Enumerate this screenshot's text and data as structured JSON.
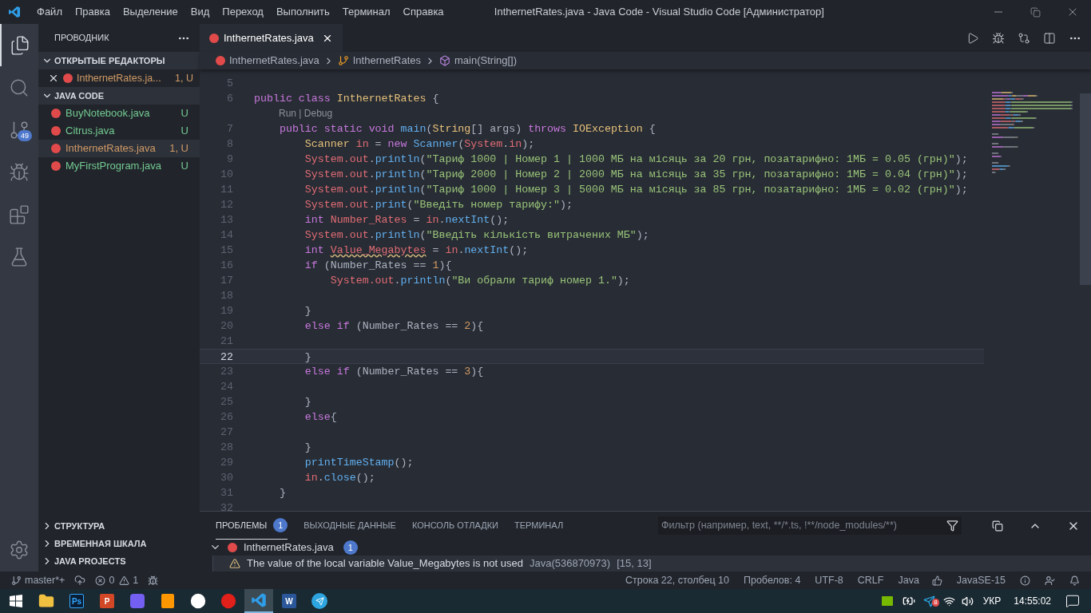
{
  "window": {
    "title": "InthernetRates.java - Java Code - Visual Studio Code [Администратор]"
  },
  "menu": [
    "Файл",
    "Правка",
    "Выделение",
    "Вид",
    "Переход",
    "Выполнить",
    "Терминал",
    "Справка"
  ],
  "activity_bar": [
    {
      "kind": "files",
      "selected": true
    },
    {
      "kind": "search",
      "selected": false
    },
    {
      "kind": "git",
      "selected": false,
      "badge": "49"
    },
    {
      "kind": "debug",
      "selected": false
    },
    {
      "kind": "extensions",
      "selected": false
    },
    {
      "kind": "testing",
      "selected": false
    }
  ],
  "sidebar": {
    "title": "ПРОВОДНИК",
    "open_editors": {
      "title": "ОТКРЫТЫЕ РЕДАКТОРЫ",
      "expanded": true,
      "items": [
        {
          "name": "InthernetRates.ja...",
          "status": "1, U",
          "color": "#d19a66"
        }
      ]
    },
    "folder": {
      "title": "JAVA CODE",
      "expanded": true,
      "items": [
        {
          "name": "BuyNotebook.java",
          "status": "U",
          "color": "#73c991",
          "selected": false
        },
        {
          "name": "Citrus.java",
          "status": "U",
          "color": "#73c991",
          "selected": false
        },
        {
          "name": "InthernetRates.java",
          "status": "1, U",
          "color": "#d19a66",
          "selected": true
        },
        {
          "name": "MyFirstProgram.java",
          "status": "U",
          "color": "#73c991",
          "selected": false
        }
      ]
    },
    "bottom_sections": [
      {
        "title": "СТРУКТУРА",
        "expanded": false
      },
      {
        "title": "ВРЕМЕННАЯ ШКАЛА",
        "expanded": false
      },
      {
        "title": "JAVA PROJECTS",
        "expanded": false
      }
    ]
  },
  "editor": {
    "tab": {
      "name": "InthernetRates.java",
      "selected": true
    },
    "breadcrumbs": [
      {
        "kind": "file",
        "text": "InthernetRates.java"
      },
      {
        "kind": "class",
        "text": "InthernetRates"
      },
      {
        "kind": "method",
        "text": "main(String[])"
      }
    ],
    "lines": [
      {
        "number": "5"
      },
      {
        "number": "6",
        "tokens": [
          {
            "kind": "k",
            "text": "public class "
          },
          {
            "kind": "t",
            "text": "InthernetRates"
          },
          {
            "kind": "p",
            "text": " {"
          }
        ]
      },
      {
        "number": "7",
        "codelens": "Run | Debug",
        "tokens": [
          {
            "kind": "k",
            "text": "    public static void "
          },
          {
            "kind": "f",
            "text": "main"
          },
          {
            "kind": "p",
            "text": "("
          },
          {
            "kind": "t",
            "text": "String"
          },
          {
            "kind": "p",
            "text": "[] args) "
          },
          {
            "kind": "k",
            "text": "throws "
          },
          {
            "kind": "t",
            "text": "IOException"
          },
          {
            "kind": "p",
            "text": " {"
          }
        ]
      },
      {
        "number": "8",
        "tokens": [
          {
            "kind": "t",
            "text": "        Scanner "
          },
          {
            "kind": "v",
            "text": "in"
          },
          {
            "kind": "p",
            "text": " = "
          },
          {
            "kind": "k",
            "text": "new "
          },
          {
            "kind": "f",
            "text": "Scanner"
          },
          {
            "kind": "p",
            "text": "("
          },
          {
            "kind": "v",
            "text": "System"
          },
          {
            "kind": "p",
            "text": "."
          },
          {
            "kind": "v",
            "text": "in"
          },
          {
            "kind": "p",
            "text": ");"
          }
        ]
      },
      {
        "number": "9",
        "tokens": [
          {
            "kind": "v",
            "text": "        System.out"
          },
          {
            "kind": "p",
            "text": "."
          },
          {
            "kind": "f",
            "text": "println"
          },
          {
            "kind": "p",
            "text": "("
          },
          {
            "kind": "s",
            "text": "\"Тариф 1000 | Номер 1 | 1000 МБ на місяць за 20 грн, позатарифно: 1МБ = 0.05 (грн)\""
          },
          {
            "kind": "p",
            "text": ");"
          }
        ]
      },
      {
        "number": "10",
        "tokens": [
          {
            "kind": "v",
            "text": "        System.out"
          },
          {
            "kind": "p",
            "text": "."
          },
          {
            "kind": "f",
            "text": "println"
          },
          {
            "kind": "p",
            "text": "("
          },
          {
            "kind": "s",
            "text": "\"Тариф 2000 | Номер 2 | 2000 МБ на місяць за 35 грн, позатарифно: 1МБ = 0.04 (грн)\""
          },
          {
            "kind": "p",
            "text": ");"
          }
        ]
      },
      {
        "number": "11",
        "tokens": [
          {
            "kind": "v",
            "text": "        System.out"
          },
          {
            "kind": "p",
            "text": "."
          },
          {
            "kind": "f",
            "text": "println"
          },
          {
            "kind": "p",
            "text": "("
          },
          {
            "kind": "s",
            "text": "\"Тариф 1000 | Номер 3 | 5000 МБ на місяць за 85 грн, позатарифно: 1МБ = 0.02 (грн)\""
          },
          {
            "kind": "p",
            "text": ");"
          }
        ]
      },
      {
        "number": "12",
        "tokens": [
          {
            "kind": "v",
            "text": "        System.out"
          },
          {
            "kind": "p",
            "text": "."
          },
          {
            "kind": "f",
            "text": "print"
          },
          {
            "kind": "p",
            "text": "("
          },
          {
            "kind": "s",
            "text": "\"Введіть номер тарифу:\""
          },
          {
            "kind": "p",
            "text": ");"
          }
        ]
      },
      {
        "number": "13",
        "tokens": [
          {
            "kind": "k",
            "text": "        int "
          },
          {
            "kind": "v",
            "text": "Number_Rates"
          },
          {
            "kind": "p",
            "text": " = "
          },
          {
            "kind": "v",
            "text": "in"
          },
          {
            "kind": "p",
            "text": "."
          },
          {
            "kind": "f",
            "text": "nextInt"
          },
          {
            "kind": "p",
            "text": "();"
          }
        ]
      },
      {
        "number": "14",
        "tokens": [
          {
            "kind": "v",
            "text": "        System.out"
          },
          {
            "kind": "p",
            "text": "."
          },
          {
            "kind": "f",
            "text": "println"
          },
          {
            "kind": "p",
            "text": "("
          },
          {
            "kind": "s",
            "text": "\"Введіть кількість витрачених МБ\""
          },
          {
            "kind": "p",
            "text": ");"
          }
        ]
      },
      {
        "number": "15",
        "tokens": [
          {
            "kind": "k",
            "text": "        int "
          },
          {
            "kind": "w",
            "text": "Value_Megabytes"
          },
          {
            "kind": "p",
            "text": " = "
          },
          {
            "kind": "v",
            "text": "in"
          },
          {
            "kind": "p",
            "text": "."
          },
          {
            "kind": "f",
            "text": "nextInt"
          },
          {
            "kind": "p",
            "text": "();"
          }
        ]
      },
      {
        "number": "16",
        "tokens": [
          {
            "kind": "k",
            "text": "        if "
          },
          {
            "kind": "p",
            "text": "(Number_Rates == "
          },
          {
            "kind": "n",
            "text": "1"
          },
          {
            "kind": "p",
            "text": "){"
          }
        ]
      },
      {
        "number": "17",
        "tokens": [
          {
            "kind": "v",
            "text": "            System.out"
          },
          {
            "kind": "p",
            "text": "."
          },
          {
            "kind": "f",
            "text": "println"
          },
          {
            "kind": "p",
            "text": "("
          },
          {
            "kind": "s",
            "text": "\"Ви обрали тариф номер 1.\""
          },
          {
            "kind": "p",
            "text": ");"
          }
        ]
      },
      {
        "number": "18"
      },
      {
        "number": "19",
        "tokens": [
          {
            "kind": "p",
            "text": "        }"
          }
        ]
      },
      {
        "number": "20",
        "tokens": [
          {
            "kind": "k",
            "text": "        else if "
          },
          {
            "kind": "p",
            "text": "(Number_Rates == "
          },
          {
            "kind": "n",
            "text": "2"
          },
          {
            "kind": "p",
            "text": "){"
          }
        ]
      },
      {
        "number": "21"
      },
      {
        "number": "22",
        "selected": true,
        "tokens": [
          {
            "kind": "p",
            "text": "        }"
          }
        ]
      },
      {
        "number": "23",
        "tokens": [
          {
            "kind": "k",
            "text": "        else if "
          },
          {
            "kind": "p",
            "text": "(Number_Rates == "
          },
          {
            "kind": "n",
            "text": "3"
          },
          {
            "kind": "p",
            "text": "){"
          }
        ]
      },
      {
        "number": "24"
      },
      {
        "number": "25",
        "tokens": [
          {
            "kind": "p",
            "text": "        }"
          }
        ]
      },
      {
        "number": "26",
        "tokens": [
          {
            "kind": "k",
            "text": "        else"
          },
          {
            "kind": "p",
            "text": "{"
          }
        ]
      },
      {
        "number": "27"
      },
      {
        "number": "28",
        "tokens": [
          {
            "kind": "p",
            "text": "        }"
          }
        ]
      },
      {
        "number": "29",
        "tokens": [
          {
            "kind": "f",
            "text": "        printTimeStamp"
          },
          {
            "kind": "p",
            "text": "();"
          }
        ]
      },
      {
        "number": "30",
        "tokens": [
          {
            "kind": "v",
            "text": "        in"
          },
          {
            "kind": "p",
            "text": "."
          },
          {
            "kind": "f",
            "text": "close"
          },
          {
            "kind": "p",
            "text": "();"
          }
        ]
      },
      {
        "number": "31",
        "tokens": [
          {
            "kind": "p",
            "text": "    }"
          }
        ]
      },
      {
        "number": "32"
      }
    ]
  },
  "panel": {
    "tabs": [
      {
        "label": "ПРОБЛЕМЫ",
        "badge": "1",
        "selected": true
      },
      {
        "label": "ВЫХОДНЫЕ ДАННЫЕ",
        "selected": false
      },
      {
        "label": "КОНСОЛЬ ОТЛАДКИ",
        "selected": false
      },
      {
        "label": "ТЕРМИНАЛ",
        "selected": false
      }
    ],
    "filter": {
      "placeholder": "Фильтр (например, text, **/*.ts, !**/node_modules/**)"
    },
    "file": {
      "name": "InthernetRates.java",
      "count": "1",
      "expanded": true
    },
    "problems": [
      {
        "message": "The value of the local variable Value_Megabytes is not used",
        "source": "Java(536870973)",
        "location": "[15, 13]"
      }
    ]
  },
  "status_bar": {
    "branch": "master*+",
    "errors": "0",
    "warnings": "1",
    "right": [
      "Строка 22, столбец 10",
      "Пробелов: 4",
      "UTF-8",
      "CRLF",
      "Java"
    ],
    "runtime": "JavaSE-15"
  },
  "taskbar": {
    "apps": [
      {
        "kind": "explorer",
        "active": false
      },
      {
        "kind": "photoshop",
        "glyph": "Ps",
        "active": false
      },
      {
        "kind": "powerpoint",
        "glyph": "P",
        "active": false
      },
      {
        "kind": "viber",
        "active": false
      },
      {
        "kind": "sublime",
        "active": false
      },
      {
        "kind": "yandex",
        "active": false
      },
      {
        "kind": "red-app",
        "active": false
      },
      {
        "kind": "vscode",
        "active": true
      },
      {
        "kind": "word",
        "glyph": "W",
        "active": false
      },
      {
        "kind": "telegram",
        "active": false
      }
    ],
    "tray_badge": "8",
    "language": "УКР",
    "time": "14:55:02"
  }
}
